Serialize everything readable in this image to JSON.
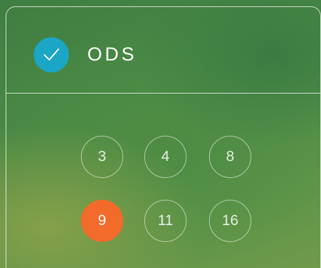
{
  "header": {
    "title": "ODS",
    "checked": true,
    "check_color": "#1aa6c4",
    "icon": "checkmark-icon"
  },
  "options": [
    {
      "label": "3",
      "selected": false
    },
    {
      "label": "4",
      "selected": false
    },
    {
      "label": "8",
      "selected": false
    },
    {
      "label": "9",
      "selected": true
    },
    {
      "label": "11",
      "selected": false
    },
    {
      "label": "16",
      "selected": false
    }
  ],
  "colors": {
    "selected": "#f26b2a",
    "border": "#ffffff"
  }
}
